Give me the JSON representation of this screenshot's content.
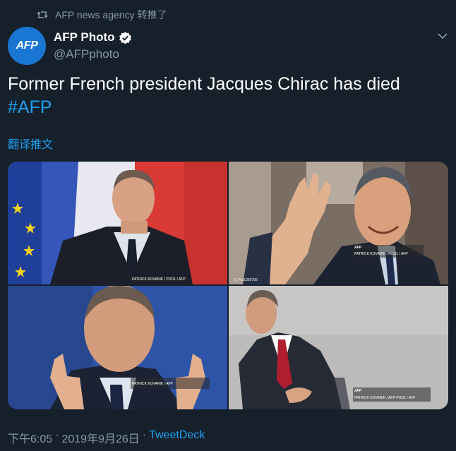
{
  "retweet": {
    "label": "AFP news agency 转推了"
  },
  "author": {
    "avatar_text": "AFP",
    "display_name": "AFP Photo",
    "handle": "@AFPphoto"
  },
  "tweet": {
    "text": "Former French president Jacques Chirac has died",
    "hashtag": "#AFP",
    "translate_label": "翻译推文"
  },
  "media": {
    "photos": [
      {
        "alt": "photo-1",
        "credit": "PATRICK KOVARIK / POOL / AFP"
      },
      {
        "alt": "photo-2",
        "credit": "PATRICK KOVARIK / POOL / AFP",
        "credit_logo": "AFP",
        "filename": "0_Par1355756"
      },
      {
        "alt": "photo-3",
        "credit": "PATRICK KOVARIK / AFP"
      },
      {
        "alt": "photo-4",
        "credit": "PATRICK KOVARIK / AFP POOL / AFP",
        "credit_logo": "AFP"
      }
    ]
  },
  "footer": {
    "time": "下午6:05",
    "separator": "·",
    "date": "2019年9月26日",
    "source": "TweetDeck"
  },
  "colors": {
    "background": "#15202b",
    "link": "#1da1f2",
    "secondary_text": "#8899a6",
    "avatar": "#1976d2"
  },
  "icons": [
    "retweet-icon",
    "verified-icon",
    "chevron-down-icon"
  ]
}
